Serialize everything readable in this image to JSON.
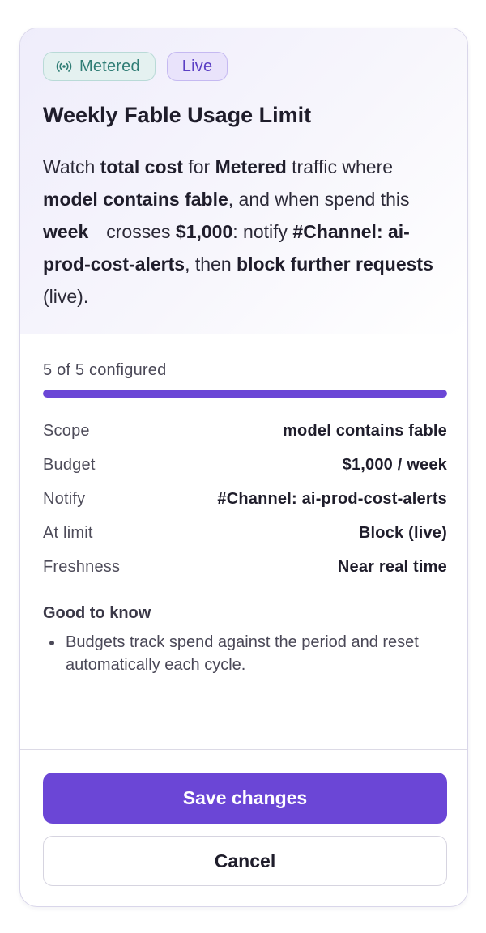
{
  "header": {
    "badges": {
      "metered": {
        "icon": "broadcast-icon",
        "label": "Metered",
        "color": "#2f7d75"
      },
      "live": {
        "label": "Live",
        "color": "#5b3fc4"
      }
    },
    "title": "Weekly Fable Usage Limit",
    "summary": {
      "t1": "Watch ",
      "b1": "total cost",
      "t2": " for ",
      "b2": "Metered",
      "t3": " traffic where ",
      "b3": "model contains fable",
      "t4": ", and when spend this ",
      "b4": "week",
      "t5": "crosses ",
      "b5": "$1,000",
      "t6": ": notify ",
      "b6": "#Channel: ai-prod-cost-alerts",
      "t7": ", then ",
      "b7": "block further requests",
      "t8": " (live)."
    }
  },
  "progress": {
    "label": "5 of 5 configured",
    "configured": 5,
    "total": 5,
    "fraction": 1.0,
    "color": "#6b46d6"
  },
  "details": [
    {
      "key": "Scope",
      "value": "model contains fable"
    },
    {
      "key": "Budget",
      "value": "$1,000 / week"
    },
    {
      "key": "Notify",
      "value": "#Channel: ai-prod-cost-alerts"
    },
    {
      "key": "At limit",
      "value": "Block (live)"
    },
    {
      "key": "Freshness",
      "value": "Near real time"
    }
  ],
  "good_to_know": {
    "title": "Good to know",
    "items": [
      "Budgets track spend against the period and reset automatically each cycle."
    ]
  },
  "actions": {
    "save_label": "Save changes",
    "cancel_label": "Cancel",
    "accent": "#6b46d6"
  }
}
